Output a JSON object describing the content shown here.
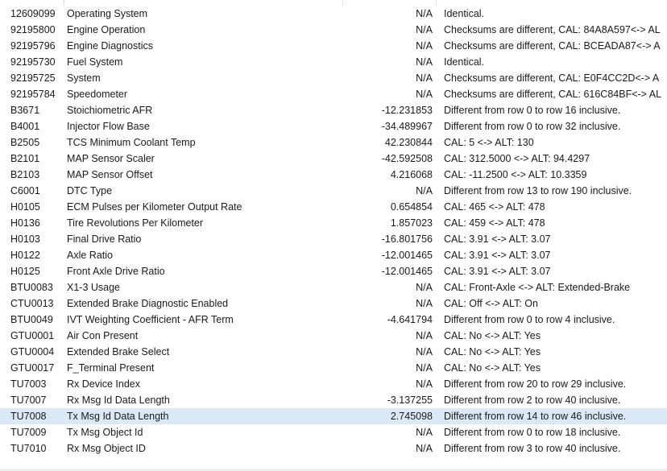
{
  "rows": [
    {
      "id": "12609099",
      "desc": "Operating System",
      "value": "N/A",
      "comment": "Identical."
    },
    {
      "id": "92195800",
      "desc": "Engine Operation",
      "value": "N/A",
      "comment": "Checksums are different, CAL: 84A8A597<-> AL"
    },
    {
      "id": "92195796",
      "desc": "Engine Diagnostics",
      "value": "N/A",
      "comment": "Checksums are different, CAL: BCEADA87<-> A"
    },
    {
      "id": "92195730",
      "desc": "Fuel System",
      "value": "N/A",
      "comment": "Identical."
    },
    {
      "id": "92195725",
      "desc": "System",
      "value": "N/A",
      "comment": "Checksums are different, CAL: E0F4CC2D<-> A"
    },
    {
      "id": "92195784",
      "desc": "Speedometer",
      "value": "N/A",
      "comment": "Checksums are different, CAL: 616C84BF<-> AL"
    },
    {
      "id": "B3671",
      "desc": "Stoichiometric AFR",
      "value": "-12.231853",
      "comment": "Different from row 0 to row 16 inclusive."
    },
    {
      "id": "B4001",
      "desc": "Injector Flow Base",
      "value": "-34.489967",
      "comment": "Different from row 0 to row 32 inclusive."
    },
    {
      "id": "B2505",
      "desc": "TCS Minimum Coolant Temp",
      "value": "42.230844",
      "comment": "CAL: 5 <-> ALT: 130"
    },
    {
      "id": "B2101",
      "desc": "MAP Sensor Scaler",
      "value": "-42.592508",
      "comment": "CAL: 312.5000 <-> ALT: 94.4297"
    },
    {
      "id": "B2103",
      "desc": "MAP Sensor Offset",
      "value": "4.216068",
      "comment": "CAL: -11.2500 <-> ALT: 10.3359"
    },
    {
      "id": "C6001",
      "desc": "DTC Type",
      "value": "N/A",
      "comment": "Different from row 13 to row 190 inclusive."
    },
    {
      "id": "H0105",
      "desc": "ECM Pulses per Kilometer Output Rate",
      "value": "0.654854",
      "comment": "CAL: 465 <-> ALT: 478"
    },
    {
      "id": "H0136",
      "desc": "Tire Revolutions Per Kilometer",
      "value": "1.857023",
      "comment": "CAL: 459 <-> ALT: 478"
    },
    {
      "id": "H0103",
      "desc": "Final Drive Ratio",
      "value": "-16.801756",
      "comment": "CAL: 3.91 <-> ALT: 3.07"
    },
    {
      "id": "H0122",
      "desc": "Axle Ratio",
      "value": "-12.001465",
      "comment": "CAL: 3.91 <-> ALT: 3.07"
    },
    {
      "id": "H0125",
      "desc": "Front Axle Drive Ratio",
      "value": "-12.001465",
      "comment": "CAL: 3.91 <-> ALT: 3.07"
    },
    {
      "id": "BTU0083",
      "desc": "X1-3 Usage",
      "value": "N/A",
      "comment": "CAL: Front-Axle <-> ALT: Extended-Brake"
    },
    {
      "id": "CTU0013",
      "desc": "Extended Brake Diagnostic Enabled",
      "value": "N/A",
      "comment": "CAL: Off <-> ALT: On"
    },
    {
      "id": "BTU0049",
      "desc": "IVT Weighting Coefficient - AFR Term",
      "value": "-4.641794",
      "comment": "Different from row 0 to row 4 inclusive."
    },
    {
      "id": "GTU0001",
      "desc": "Air Con Present",
      "value": "N/A",
      "comment": "CAL: No <-> ALT: Yes"
    },
    {
      "id": "GTU0004",
      "desc": "Extended Brake Select",
      "value": "N/A",
      "comment": "CAL: No <-> ALT: Yes"
    },
    {
      "id": "GTU0017",
      "desc": "F_Terminal Present",
      "value": "N/A",
      "comment": "CAL: No <-> ALT: Yes"
    },
    {
      "id": "TU7003",
      "desc": "Rx Device Index",
      "value": "N/A",
      "comment": "Different from row 20 to row 29 inclusive."
    },
    {
      "id": "TU7007",
      "desc": "Rx Msg Id Data Length",
      "value": "-3.137255",
      "comment": "Different from row 2 to row 40 inclusive."
    },
    {
      "id": "TU7008",
      "desc": "Tx Msg Id Data Length",
      "value": "2.745098",
      "comment": "Different from row 14 to row 46 inclusive.",
      "selected": true
    },
    {
      "id": "TU7009",
      "desc": "Tx Msg Object Id",
      "value": "N/A",
      "comment": "Different from row 0 to row 18 inclusive."
    },
    {
      "id": "TU7010",
      "desc": "Rx Msg Object ID",
      "value": "N/A",
      "comment": "Different from row 3 to row 40 inclusive."
    }
  ]
}
